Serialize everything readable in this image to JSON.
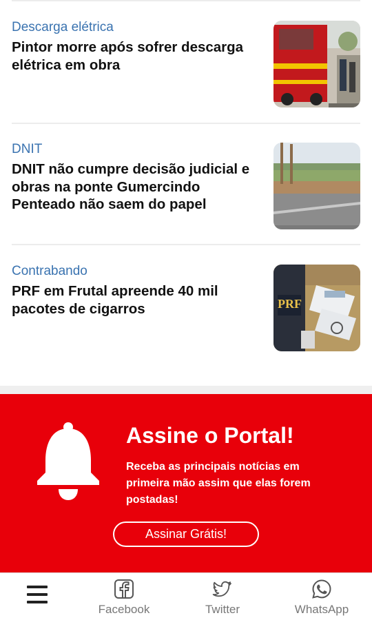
{
  "news": [
    {
      "category": "Descarga elétrica",
      "headline": "Pintor morre após sofrer descarga elétrica em obra",
      "image": "fire-truck-accident-photo"
    },
    {
      "category": "DNIT",
      "headline": "DNIT não cumpre decisão judicial e obras na ponte Gumercindo Penteado não saem do papel",
      "image": "bridge-road-photo"
    },
    {
      "category": "Contrabando",
      "headline": "PRF em Frutal apreende 40 mil pacotes de cigarros",
      "image": "prf-cigarettes-seizure-photo"
    }
  ],
  "subscribe": {
    "title": "Assine o Portal!",
    "text": "Receba as principais notícias em primeira mão assim que elas forem postadas!",
    "button_label": "Assinar Grátis!",
    "icon": "bell-icon",
    "background": "#e8000a"
  },
  "bottom_nav": {
    "menu_icon": "hamburger-menu-icon",
    "items": [
      {
        "label": "Facebook",
        "icon": "facebook-icon"
      },
      {
        "label": "Twitter",
        "icon": "twitter-icon"
      },
      {
        "label": "WhatsApp",
        "icon": "whatsapp-icon"
      }
    ]
  },
  "colors": {
    "category": "#3a73b0",
    "headline": "#111111",
    "accent_red": "#e8000a"
  }
}
